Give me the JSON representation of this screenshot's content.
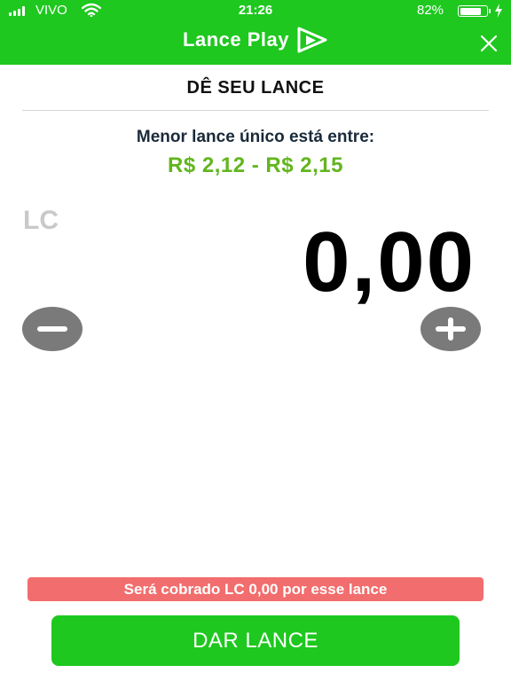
{
  "status_bar": {
    "carrier": "VIVO",
    "time": "21:26",
    "battery_percent": "82%",
    "battery_level": 0.82,
    "icons": [
      "signal-icon",
      "wifi-icon",
      "battery-icon",
      "charging-bolt-icon"
    ]
  },
  "header": {
    "brand_name": "Lance Play",
    "logo_icon": "lance-play-logo-icon",
    "close_icon": "close-icon",
    "background_color": "#1ec81f"
  },
  "bid_panel": {
    "title": "DÊ SEU LANCE",
    "range_label": "Menor lance único está entre:",
    "range_value": "R$ 2,12 - R$ 2,15",
    "range_color": "#62b51e",
    "currency": "LC",
    "amount": "0,00",
    "decrement_icon": "minus-icon",
    "increment_icon": "plus-icon"
  },
  "footer": {
    "charge_notice": "Será cobrado LC 0,00 por esse lance",
    "charge_notice_color": "#f26d6d",
    "submit_label": "DAR LANCE",
    "submit_color": "#1ec81f"
  }
}
